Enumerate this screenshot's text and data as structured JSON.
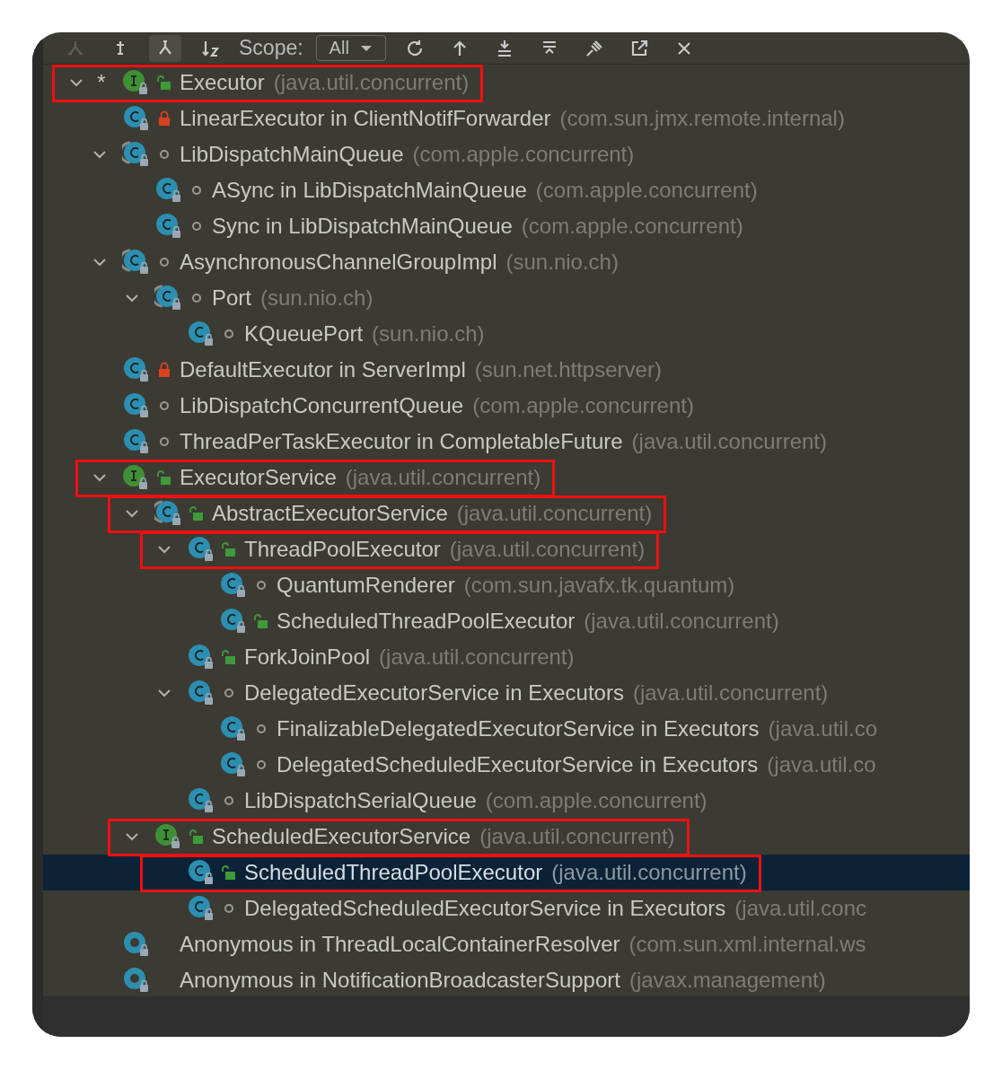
{
  "toolbar": {
    "left_buttons": [
      {
        "kind": "hierarchy",
        "selected": false,
        "disabled": true
      },
      {
        "kind": "supertypes",
        "selected": false,
        "disabled": false
      },
      {
        "kind": "subtypes",
        "selected": true,
        "disabled": false
      },
      {
        "kind": "sort",
        "selected": false,
        "disabled": false
      }
    ],
    "scope_label": "Scope:",
    "scope_value": "All",
    "right_buttons": [
      {
        "kind": "refresh",
        "selected": false,
        "disabled": false
      },
      {
        "kind": "to-base",
        "selected": false,
        "disabled": false
      },
      {
        "kind": "expand",
        "selected": false,
        "disabled": false
      },
      {
        "kind": "collapse",
        "selected": false,
        "disabled": false
      },
      {
        "kind": "pin",
        "selected": false,
        "disabled": false
      },
      {
        "kind": "export",
        "selected": false,
        "disabled": false
      },
      {
        "kind": "close",
        "selected": false,
        "disabled": false
      }
    ]
  },
  "tree": [
    {
      "marker": "*",
      "name": "Executor",
      "package": "(java.util.concurrent)",
      "kind": "interface",
      "modifier": {
        "kind": "public"
      },
      "expanded": true,
      "selected": false,
      "highlighted": true,
      "children": [
        {
          "name": "LinearExecutor in ClientNotifForwarder",
          "package": "(com.sun.jmx.remote.internal)",
          "kind": "class",
          "modifier": {
            "kind": "private"
          },
          "selected": false,
          "highlighted": false
        },
        {
          "name": "LibDispatchMainQueue",
          "package": "(com.apple.concurrent)",
          "kind": "abstract",
          "modifier": {
            "kind": "package"
          },
          "expanded": true,
          "selected": false,
          "highlighted": false,
          "children": [
            {
              "name": "ASync in LibDispatchMainQueue",
              "package": "(com.apple.concurrent)",
              "kind": "class",
              "modifier": {
                "kind": "package"
              },
              "selected": false,
              "highlighted": false
            },
            {
              "name": "Sync in LibDispatchMainQueue",
              "package": "(com.apple.concurrent)",
              "kind": "class",
              "modifier": {
                "kind": "package"
              },
              "selected": false,
              "highlighted": false
            }
          ]
        },
        {
          "name": "AsynchronousChannelGroupImpl",
          "package": "(sun.nio.ch)",
          "kind": "abstract",
          "modifier": {
            "kind": "package"
          },
          "expanded": true,
          "selected": false,
          "highlighted": false,
          "children": [
            {
              "name": "Port",
              "package": "(sun.nio.ch)",
              "kind": "abstract",
              "modifier": {
                "kind": "package"
              },
              "expanded": true,
              "selected": false,
              "highlighted": false,
              "children": [
                {
                  "name": "KQueuePort",
                  "package": "(sun.nio.ch)",
                  "kind": "class",
                  "modifier": {
                    "kind": "package"
                  },
                  "selected": false,
                  "highlighted": false
                }
              ]
            }
          ]
        },
        {
          "name": "DefaultExecutor in ServerImpl",
          "package": "(sun.net.httpserver)",
          "kind": "class",
          "modifier": {
            "kind": "private"
          },
          "selected": false,
          "highlighted": false
        },
        {
          "name": "LibDispatchConcurrentQueue",
          "package": "(com.apple.concurrent)",
          "kind": "class",
          "modifier": {
            "kind": "package"
          },
          "selected": false,
          "highlighted": false
        },
        {
          "name": "ThreadPerTaskExecutor in CompletableFuture",
          "package": "(java.util.concurrent)",
          "kind": "class",
          "modifier": {
            "kind": "package"
          },
          "selected": false,
          "highlighted": false
        },
        {
          "name": "ExecutorService",
          "package": "(java.util.concurrent)",
          "kind": "interface",
          "modifier": {
            "kind": "public"
          },
          "expanded": true,
          "selected": false,
          "highlighted": true,
          "children": [
            {
              "name": "AbstractExecutorService",
              "package": "(java.util.concurrent)",
              "kind": "abstract",
              "modifier": {
                "kind": "public"
              },
              "expanded": true,
              "selected": false,
              "highlighted": true,
              "children": [
                {
                  "name": "ThreadPoolExecutor",
                  "package": "(java.util.concurrent)",
                  "kind": "class",
                  "modifier": {
                    "kind": "public"
                  },
                  "expanded": true,
                  "selected": false,
                  "highlighted": true,
                  "children": [
                    {
                      "name": "QuantumRenderer",
                      "package": "(com.sun.javafx.tk.quantum)",
                      "kind": "class",
                      "modifier": {
                        "kind": "package"
                      },
                      "selected": false,
                      "highlighted": false
                    },
                    {
                      "name": "ScheduledThreadPoolExecutor",
                      "package": "(java.util.concurrent)",
                      "kind": "class",
                      "modifier": {
                        "kind": "public"
                      },
                      "selected": false,
                      "highlighted": false
                    }
                  ]
                },
                {
                  "name": "ForkJoinPool",
                  "package": "(java.util.concurrent)",
                  "kind": "class",
                  "modifier": {
                    "kind": "public"
                  },
                  "selected": false,
                  "highlighted": false
                },
                {
                  "name": "DelegatedExecutorService in Executors",
                  "package": "(java.util.concurrent)",
                  "kind": "class",
                  "modifier": {
                    "kind": "package"
                  },
                  "expanded": true,
                  "selected": false,
                  "highlighted": false,
                  "children": [
                    {
                      "name": "FinalizableDelegatedExecutorService in Executors",
                      "package": "(java.util.co",
                      "kind": "class",
                      "modifier": {
                        "kind": "package"
                      },
                      "selected": false,
                      "highlighted": false
                    },
                    {
                      "name": "DelegatedScheduledExecutorService in Executors",
                      "package": "(java.util.co",
                      "kind": "class",
                      "modifier": {
                        "kind": "package"
                      },
                      "selected": false,
                      "highlighted": false
                    }
                  ]
                },
                {
                  "name": "LibDispatchSerialQueue",
                  "package": "(com.apple.concurrent)",
                  "kind": "class",
                  "modifier": {
                    "kind": "package"
                  },
                  "selected": false,
                  "highlighted": false
                }
              ]
            },
            {
              "name": "ScheduledExecutorService",
              "package": "(java.util.concurrent)",
              "kind": "interface",
              "modifier": {
                "kind": "public"
              },
              "expanded": true,
              "selected": false,
              "highlighted": true,
              "children": [
                {
                  "name": "ScheduledThreadPoolExecutor",
                  "package": "(java.util.concurrent)",
                  "kind": "class",
                  "modifier": {
                    "kind": "public"
                  },
                  "selected": true,
                  "highlighted": true
                },
                {
                  "name": "DelegatedScheduledExecutorService in Executors",
                  "package": "(java.util.conc",
                  "kind": "class",
                  "modifier": {
                    "kind": "package"
                  },
                  "selected": false,
                  "highlighted": false
                }
              ]
            }
          ]
        },
        {
          "name": "Anonymous in ThreadLocalContainerResolver",
          "package": "(com.sun.xml.internal.ws",
          "kind": "anonymous",
          "selected": false,
          "highlighted": false
        },
        {
          "name": "Anonymous in NotificationBroadcasterSupport",
          "package": "(javax.management)",
          "kind": "anonymous",
          "selected": false,
          "highlighted": false
        }
      ]
    }
  ]
}
